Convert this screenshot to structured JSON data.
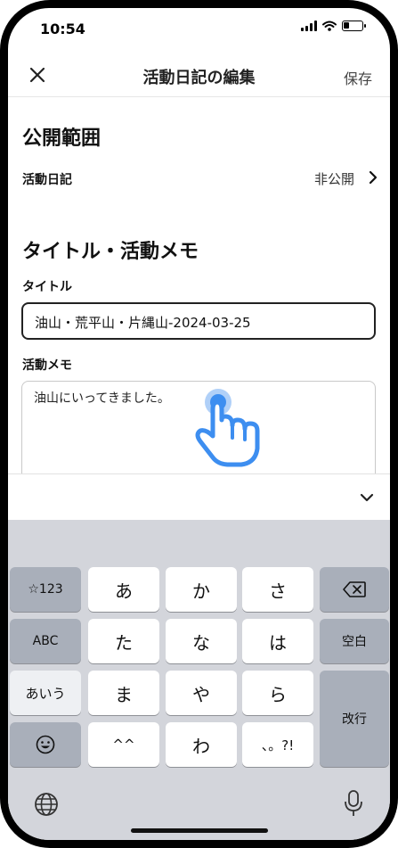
{
  "status": {
    "time": "10:54"
  },
  "nav": {
    "title": "活動日記の編集",
    "save_label": "保存"
  },
  "sections": {
    "privacy_heading": "公開範囲",
    "privacy_row_label": "活動日記",
    "privacy_row_value": "非公開",
    "title_memo_heading": "タイトル・活動メモ",
    "title_label": "タイトル",
    "title_value": "油山・荒平山・片縄山-2024-03-25",
    "memo_label": "活動メモ",
    "memo_value": "油山にいってきました。"
  },
  "keyboard": {
    "row1": [
      "☆123",
      "あ",
      "か",
      "さ"
    ],
    "row2": [
      "ABC",
      "た",
      "な",
      "は",
      "空白"
    ],
    "row3": [
      "あいう",
      "ま",
      "や",
      "ら",
      "改行"
    ],
    "row4": [
      "^^",
      "わ",
      "、。?!"
    ],
    "colors": {
      "keyboard_bg": "#d3d5db",
      "key_bg": "#ffffff",
      "fn_key_bg": "#a9afba",
      "accent": "#3d8ef0"
    }
  }
}
